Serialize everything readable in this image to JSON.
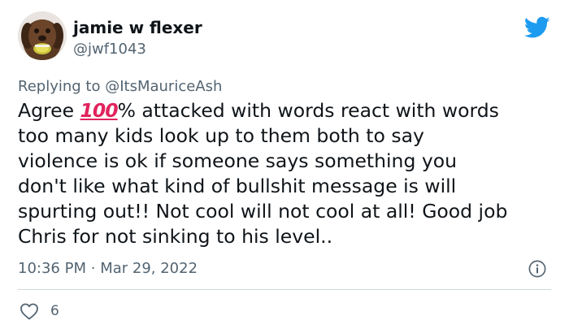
{
  "author": {
    "display_name": "jamie w flexer",
    "handle": "@jwf1043"
  },
  "reply_context": {
    "prefix": "Replying to",
    "mention": "@ItsMauriceAsh"
  },
  "body": {
    "lines": [
      {
        "before": "Agree ",
        "emoji": "100",
        "after": "% attacked with words react with words"
      },
      "too many kids look up to them both to say",
      "violence is ok if someone says something you",
      "don't like what kind of bullshit message is will",
      "spurting out!! Not cool will not cool at all! Good job",
      "Chris for not sinking to his level.."
    ]
  },
  "meta": {
    "time": "10:36 PM",
    "separator": "·",
    "date": "Mar 29, 2022"
  },
  "engagement": {
    "likes": "6"
  },
  "icons": {
    "brand": "twitter-bird-icon",
    "info": "info-icon",
    "like": "heart-icon",
    "emoji": "hundred-points-emoji"
  },
  "colors": {
    "text": "#0f1419",
    "secondary": "#536471",
    "twitter_blue": "#1d9bf0",
    "divider": "#cfd9de",
    "emoji_red": "#e0245e"
  }
}
